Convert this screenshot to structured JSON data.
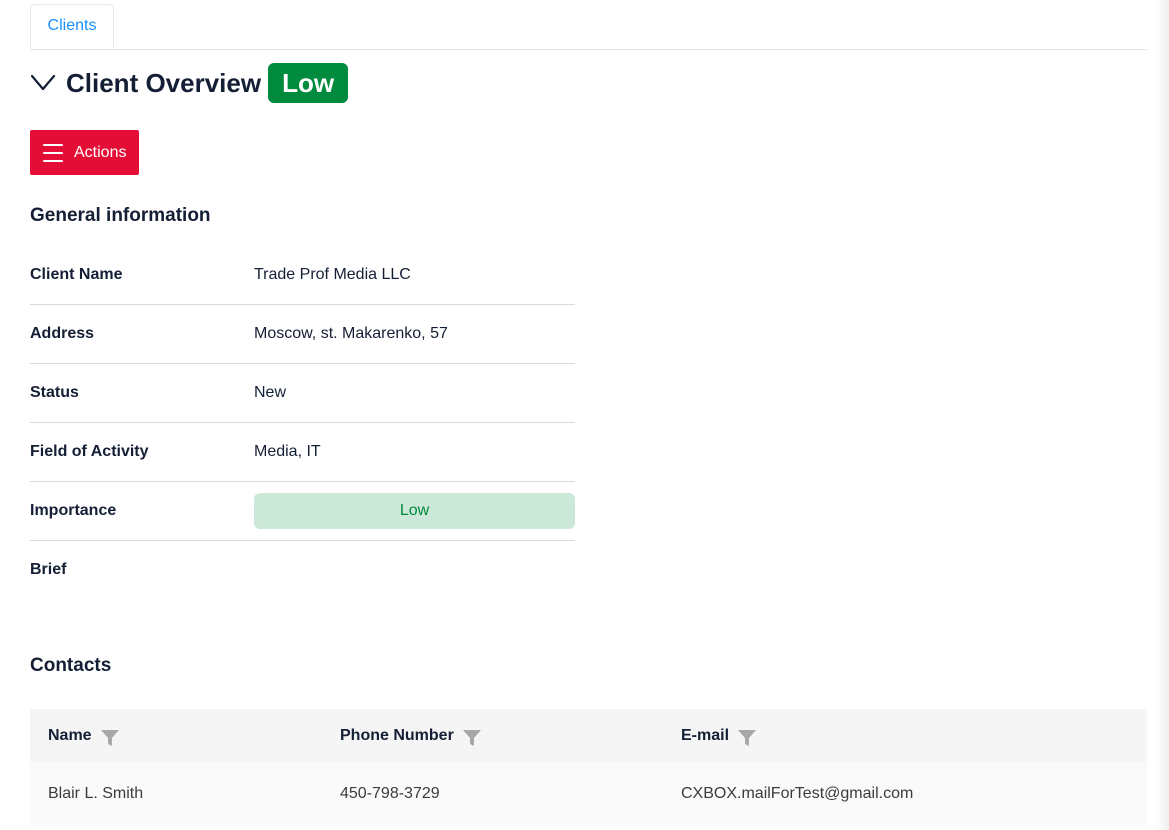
{
  "tabs": [
    {
      "label": "Clients"
    }
  ],
  "header": {
    "title": "Client Overview",
    "badge": "Low",
    "badge_color": "#008a3e"
  },
  "actions": {
    "label": "Actions",
    "color": "#e30d35"
  },
  "general": {
    "title": "General information",
    "rows": [
      {
        "label": "Client Name",
        "value": "Trade Prof Media LLC"
      },
      {
        "label": "Address",
        "value": "Moscow, st. Makarenko, 57"
      },
      {
        "label": "Status",
        "value": "New"
      },
      {
        "label": "Field of Activity",
        "value": "Media, IT"
      },
      {
        "label": "Importance",
        "value": "Low"
      },
      {
        "label": "Brief",
        "value": ""
      }
    ]
  },
  "contacts": {
    "title": "Contacts",
    "columns": [
      "Name",
      "Phone Number",
      "E-mail"
    ],
    "rows": [
      {
        "name": "Blair L. Smith",
        "phone": "450-798-3729",
        "email": "CXBOX.mailForTest@gmail.com"
      }
    ]
  },
  "icons": {
    "collapse": "chevron-down-icon",
    "menu": "hamburger-menu-icon",
    "filter": "filter-icon"
  }
}
